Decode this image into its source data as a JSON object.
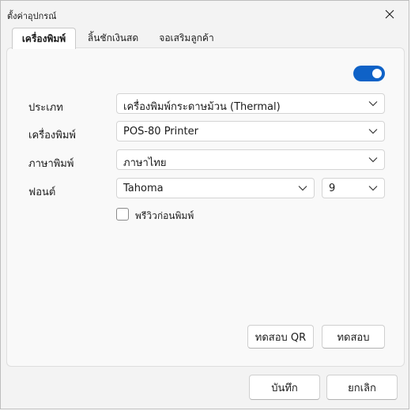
{
  "window": {
    "title": "ตั้งค่าอุปกรณ์"
  },
  "tabs": [
    {
      "label": "เครื่องพิมพ์",
      "active": true
    },
    {
      "label": "ลิ้นชักเงินสด",
      "active": false
    },
    {
      "label": "จอเสริมลูกค้า",
      "active": false
    }
  ],
  "printer_settings": {
    "enabled": true,
    "accent_color": "#0f62c7",
    "type_label": "ประเภท",
    "type_value": "เครื่องพิมพ์กระดาษม้วน (Thermal)",
    "printer_label": "เครื่องพิมพ์",
    "printer_value": "POS-80 Printer",
    "language_label": "ภาษาพิมพ์",
    "language_value": "ภาษาไทย",
    "font_label": "ฟอนต์",
    "font_value": "Tahoma",
    "font_size_value": "9",
    "preview_label": "พรีวิวก่อนพิมพ์",
    "preview_checked": false,
    "test_qr_label": "ทดสอบ QR",
    "test_label": "ทดสอบ"
  },
  "footer": {
    "save_label": "บันทึก",
    "cancel_label": "ยกเลิก"
  }
}
